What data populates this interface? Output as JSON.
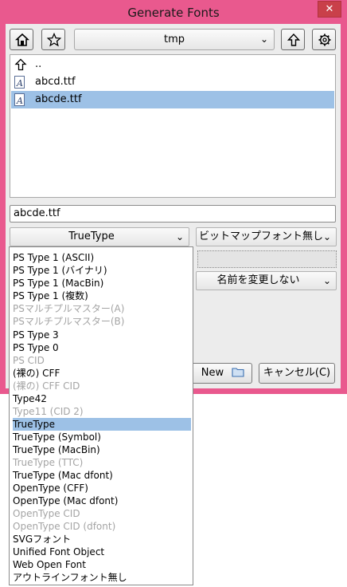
{
  "window": {
    "title": "Generate Fonts",
    "close_glyph": "✕"
  },
  "toolbar": {
    "path": "tmp"
  },
  "files": [
    {
      "name": "..",
      "icon": "up-arrow-icon",
      "selected": false
    },
    {
      "name": "abcd.ttf",
      "icon": "font-file-icon",
      "selected": false
    },
    {
      "name": "abcde.ttf",
      "icon": "font-file-icon",
      "selected": true
    }
  ],
  "filename": "abcde.ttf",
  "format_select": {
    "value": "TrueType"
  },
  "bitmap_select": {
    "value": "ビットマップフォント無し"
  },
  "rename_select": {
    "value": "名前を変更しない"
  },
  "buttons": {
    "new_label": "New",
    "cancel_label": "キャンセル(C)"
  },
  "format_options": [
    {
      "label": "PS Type 1 (ASCII)",
      "enabled": true,
      "selected": false
    },
    {
      "label": "PS Type 1 (バイナリ)",
      "enabled": true,
      "selected": false
    },
    {
      "label": "PS Type 1 (MacBin)",
      "enabled": true,
      "selected": false
    },
    {
      "label": "PS Type 1 (複数)",
      "enabled": true,
      "selected": false
    },
    {
      "label": "PSマルチプルマスター(A)",
      "enabled": false,
      "selected": false
    },
    {
      "label": "PSマルチプルマスター(B)",
      "enabled": false,
      "selected": false
    },
    {
      "label": "PS Type 3",
      "enabled": true,
      "selected": false
    },
    {
      "label": "PS Type 0",
      "enabled": true,
      "selected": false
    },
    {
      "label": "PS CID",
      "enabled": false,
      "selected": false
    },
    {
      "label": "(裸の) CFF",
      "enabled": true,
      "selected": false
    },
    {
      "label": "(裸の) CFF CID",
      "enabled": false,
      "selected": false
    },
    {
      "label": "Type42",
      "enabled": true,
      "selected": false
    },
    {
      "label": "Type11 (CID 2)",
      "enabled": false,
      "selected": false
    },
    {
      "label": "TrueType",
      "enabled": true,
      "selected": true
    },
    {
      "label": "TrueType (Symbol)",
      "enabled": true,
      "selected": false
    },
    {
      "label": "TrueType (MacBin)",
      "enabled": true,
      "selected": false
    },
    {
      "label": "TrueType (TTC)",
      "enabled": false,
      "selected": false
    },
    {
      "label": "TrueType (Mac dfont)",
      "enabled": true,
      "selected": false
    },
    {
      "label": "OpenType (CFF)",
      "enabled": true,
      "selected": false
    },
    {
      "label": "OpenType (Mac dfont)",
      "enabled": true,
      "selected": false
    },
    {
      "label": "OpenType CID",
      "enabled": false,
      "selected": false
    },
    {
      "label": "OpenType CID (dfont)",
      "enabled": false,
      "selected": false
    },
    {
      "label": "SVGフォント",
      "enabled": true,
      "selected": false
    },
    {
      "label": "Unified Font Object",
      "enabled": true,
      "selected": false
    },
    {
      "label": "Web Open Font",
      "enabled": true,
      "selected": false
    },
    {
      "label": "アウトラインフォント無し",
      "enabled": true,
      "selected": false
    }
  ],
  "colors": {
    "frame": "#e9598e",
    "selection": "#9dc1e6",
    "disabled_text": "#a4a4a4"
  }
}
